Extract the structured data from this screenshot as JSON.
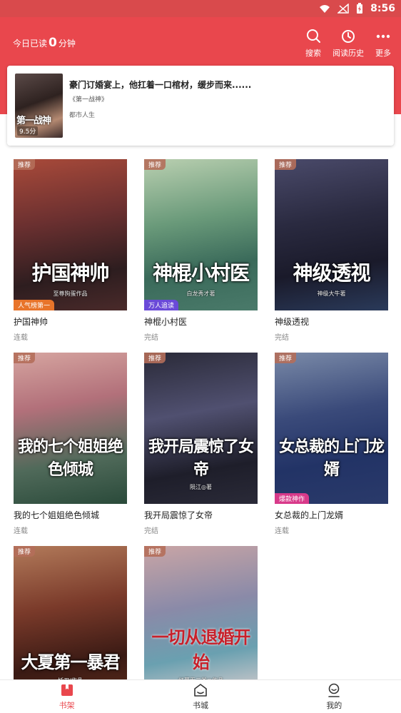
{
  "statusbar": {
    "time": "8:56"
  },
  "header": {
    "reading_prefix": "今日已读",
    "reading_minutes": "0",
    "reading_suffix": "分钟",
    "actions": [
      {
        "label": "搜索",
        "icon": "search-icon"
      },
      {
        "label": "阅读历史",
        "icon": "history-icon"
      },
      {
        "label": "更多",
        "icon": "more-icon"
      }
    ]
  },
  "recent": {
    "title": "豪门订婚宴上，他扛着一口棺材，缓步而来......",
    "chapter": "《第一战神》",
    "category": "都市人生",
    "cover_text": "第一战神",
    "score": "9.5分"
  },
  "books": [
    {
      "title": "护国神帅",
      "status": "连载",
      "badge": "推荐",
      "cover_text": "护国神帅",
      "cover_sub": "至尊狗蛋作品",
      "bottom_tag": "人气榜第一",
      "bottom_tag_color": "#e8742a"
    },
    {
      "title": "神棍小村医",
      "status": "完结",
      "badge": "推荐",
      "cover_text": "神棍小村医",
      "cover_sub": "白龙秀才著",
      "bottom_tag": "万人追读",
      "bottom_tag_color": "#6a4ad8"
    },
    {
      "title": "神级透视",
      "status": "完结",
      "badge": "推荐",
      "cover_text": "神级透视",
      "cover_sub": "神级大牛著",
      "bottom_tag": "",
      "bottom_tag_color": ""
    },
    {
      "title": "我的七个姐姐绝色倾城",
      "status": "连载",
      "badge": "推荐",
      "cover_text": "我的七个姐姐绝色倾城",
      "cover_sub": "",
      "bottom_tag": "",
      "bottom_tag_color": ""
    },
    {
      "title": "我开局震惊了女帝",
      "status": "完结",
      "badge": "推荐",
      "cover_text": "我开局震惊了女帝",
      "cover_sub": "陨江◎著",
      "bottom_tag": "",
      "bottom_tag_color": ""
    },
    {
      "title": "女总裁的上门龙婿",
      "status": "连载",
      "badge": "推荐",
      "cover_text": "女总裁的上门龙婿",
      "cover_sub": "",
      "bottom_tag": "爆款神作",
      "bottom_tag_color": "#d83a8a"
    },
    {
      "title": "",
      "status": "",
      "badge": "推荐",
      "cover_text": "大夏第一暴君",
      "cover_sub": "妖刀/作品",
      "bottom_tag": "",
      "bottom_tag_color": ""
    },
    {
      "title": "",
      "status": "",
      "badge": "推荐",
      "cover_text": "一切从退婚开始",
      "cover_sub": "红薯吞二爷◎作品",
      "bottom_tag": "",
      "bottom_tag_color": ""
    }
  ],
  "nav": [
    {
      "label": "书架",
      "icon": "bookshelf-icon",
      "active": true
    },
    {
      "label": "书城",
      "icon": "bookstore-icon",
      "active": false
    },
    {
      "label": "我的",
      "icon": "profile-icon",
      "active": false
    }
  ],
  "colors": {
    "primary": "#e9474d",
    "status": "#d94a4c"
  }
}
